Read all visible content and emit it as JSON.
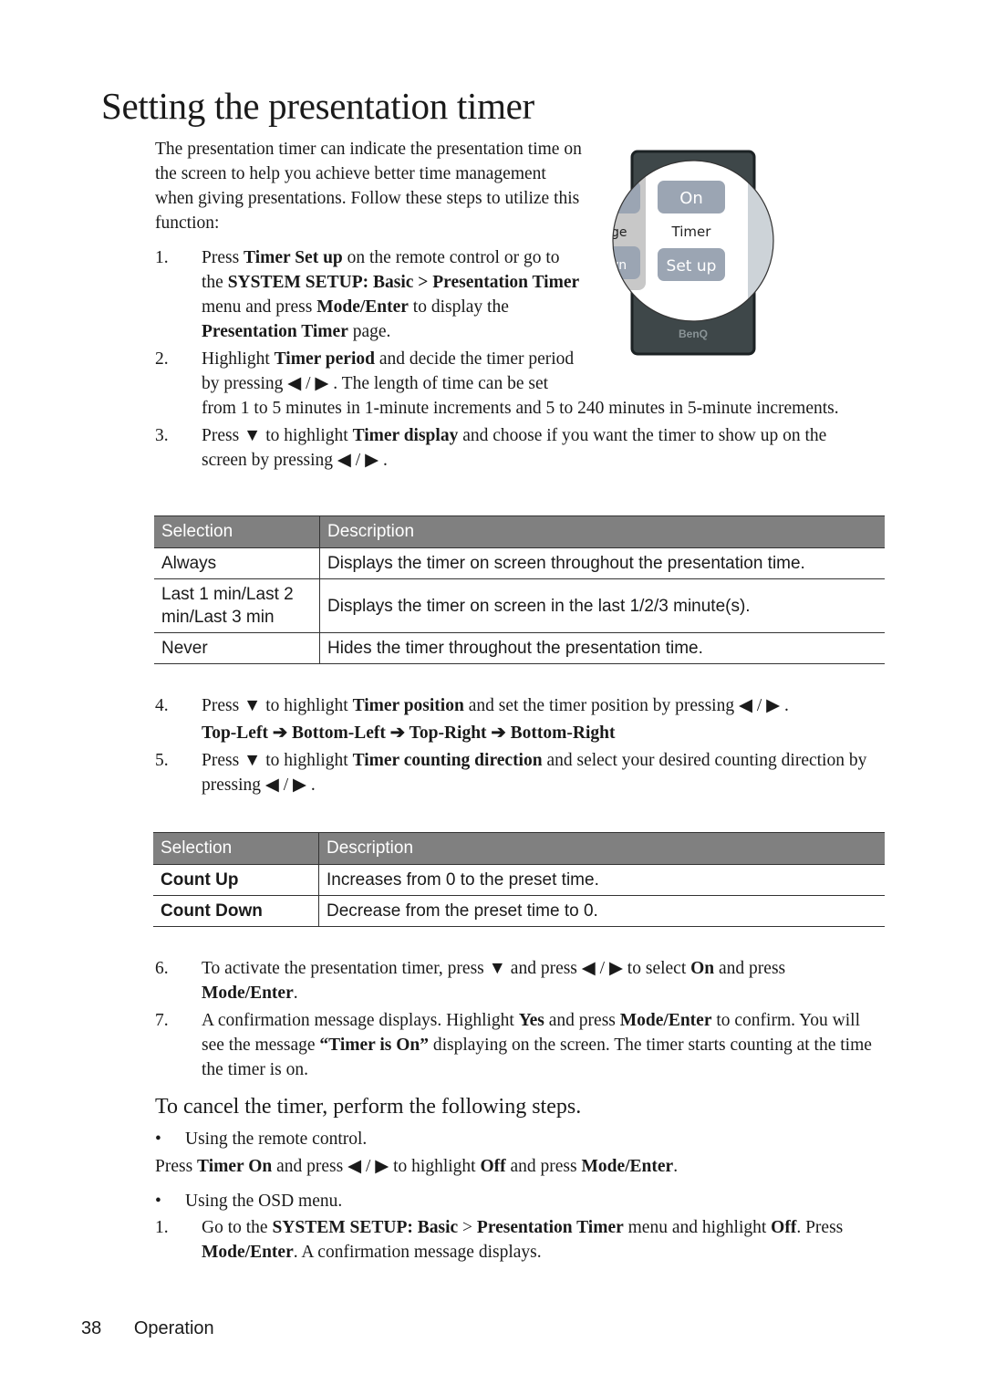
{
  "title": "Setting the presentation timer",
  "remote_image": {
    "on": "On",
    "timer": "Timer",
    "setup": "Set up",
    "left_partial_1": "ge",
    "left_partial_2": "vn",
    "brand": "BenQ"
  },
  "intro": [
    {
      "t": "The presentation timer can indicate the presentation time on the screen to help you achieve better time management when giving presentations. Follow these steps to utilize this function:"
    }
  ],
  "steps_a": [
    {
      "num": "1.",
      "segs": [
        {
          "t": "Press "
        },
        {
          "t": "Timer Set up",
          "b": true
        },
        {
          "t": " on the remote control or go to the "
        },
        {
          "t": "SYSTEM SETUP: Basic > Presentation Timer",
          "b": true
        },
        {
          "t": " menu and press "
        },
        {
          "t": "Mode/Enter",
          "b": true
        },
        {
          "t": " to display the "
        },
        {
          "t": "Presentation Timer",
          "b": true
        },
        {
          "t": " page."
        }
      ]
    },
    {
      "num": "2.",
      "segs": [
        {
          "t": "Highlight "
        },
        {
          "t": "Timer period",
          "b": true
        },
        {
          "t": " and decide the timer period by pressing ◀ / ▶ . The length of time can be set from 1 to 5 minutes in 1-minute increments and 5 to 240 minutes in 5-minute increments."
        }
      ]
    },
    {
      "num": "3.",
      "segs": [
        {
          "t": "Press ▼ to highlight "
        },
        {
          "t": "Timer display",
          "b": true
        },
        {
          "t": " and choose if you want the timer to show up on the screen by pressing ◀ / ▶ ."
        }
      ]
    }
  ],
  "table1": {
    "headers": [
      "Selection",
      "Description"
    ],
    "rows": [
      [
        "Always",
        "Displays the timer on screen throughout the presentation time."
      ],
      [
        "Last 1 min/Last 2 min/Last 3 min",
        "Displays the timer on screen in the last 1/2/3 minute(s)."
      ],
      [
        "Never",
        "Hides the timer throughout the presentation time."
      ]
    ]
  },
  "steps_b": [
    {
      "num": "4.",
      "segs": [
        {
          "t": "Press ▼ to highlight "
        },
        {
          "t": "Timer position",
          "b": true
        },
        {
          "t": " and set the timer position by pressing ◀ / ▶ ."
        }
      ]
    },
    {
      "num": "",
      "segs": [
        {
          "t": "Top-Left ➔ Bottom-Left ➔ Top-Right ➔ Bottom-Right",
          "b": true
        }
      ]
    },
    {
      "num": "5.",
      "segs": [
        {
          "t": "Press ▼ to highlight "
        },
        {
          "t": "Timer counting direction",
          "b": true
        },
        {
          "t": " and select your desired counting direction by pressing ◀ / ▶ ."
        }
      ]
    }
  ],
  "table2": {
    "headers": [
      "Selection",
      "Description"
    ],
    "rows": [
      [
        "Count Up",
        "Increases from 0 to the preset time."
      ],
      [
        "Count Down",
        "Decrease from the preset time to 0."
      ]
    ]
  },
  "steps_c": [
    {
      "num": "6.",
      "segs": [
        {
          "t": "To activate the presentation timer, press ▼ and press ◀ / ▶ to select "
        },
        {
          "t": "On",
          "b": true
        },
        {
          "t": " and press "
        },
        {
          "t": "Mode/Enter",
          "b": true
        },
        {
          "t": "."
        }
      ]
    },
    {
      "num": "7.",
      "segs": [
        {
          "t": "A confirmation message displays. Highlight "
        },
        {
          "t": "Yes",
          "b": true
        },
        {
          "t": " and press "
        },
        {
          "t": "Mode/Enter",
          "b": true
        },
        {
          "t": " to confirm. You will see the message "
        },
        {
          "t": "“Timer is On”",
          "b": true
        },
        {
          "t": " displaying on the screen. The timer starts counting at the time the timer is on."
        }
      ]
    }
  ],
  "cancel_heading": "To cancel the timer, perform the following steps.",
  "cancel": {
    "bullet1": "Using the remote control.",
    "remote_line": [
      {
        "t": "Press "
      },
      {
        "t": "Timer On",
        "b": true
      },
      {
        "t": " and press ◀ / ▶ to highlight "
      },
      {
        "t": "Off",
        "b": true
      },
      {
        "t": " and press "
      },
      {
        "t": "Mode/Enter",
        "b": true
      },
      {
        "t": "."
      }
    ],
    "bullet2": "Using the OSD menu.",
    "osd_step": {
      "num": "1.",
      "segs": [
        {
          "t": "Go to the "
        },
        {
          "t": "SYSTEM SETUP: Basic",
          "b": true
        },
        {
          "t": " > "
        },
        {
          "t": "Presentation Timer",
          "b": true
        },
        {
          "t": " menu and highlight "
        },
        {
          "t": "Off",
          "b": true
        },
        {
          "t": ". Press "
        },
        {
          "t": "Mode/Enter",
          "b": true
        },
        {
          "t": ". A confirmation message displays."
        }
      ]
    }
  },
  "footer": {
    "page": "38",
    "section": "Operation"
  }
}
